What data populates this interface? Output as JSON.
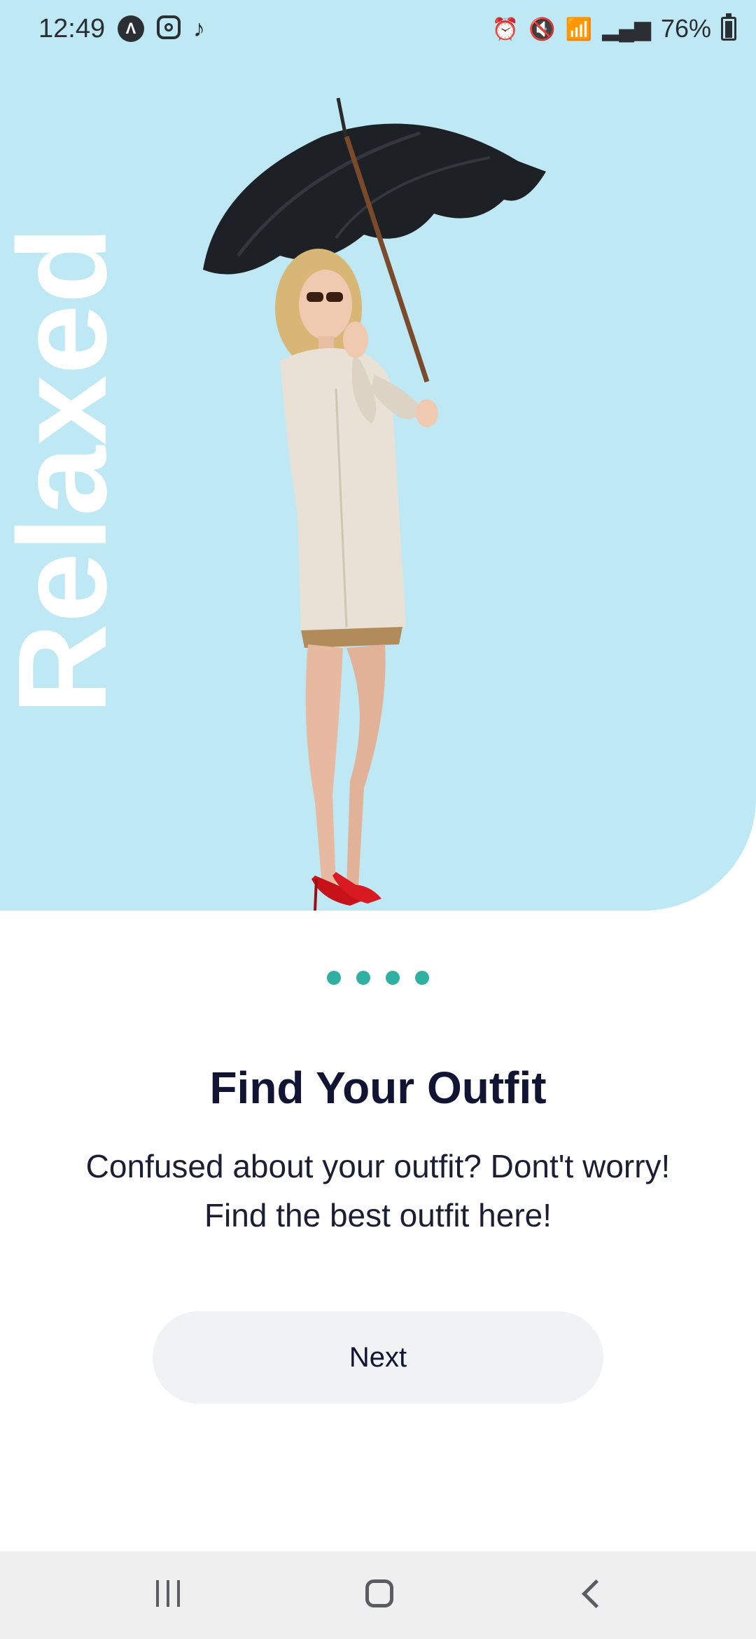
{
  "status_bar": {
    "time": "12:49",
    "battery": "76%",
    "left_icons": [
      "a-letter-icon",
      "instagram-icon",
      "music-note-icon"
    ],
    "right_icons": [
      "alarm-icon",
      "mute-icon",
      "wifi-icon",
      "signal-icon",
      "signal-icon",
      "battery-icon"
    ]
  },
  "hero": {
    "vertical_word": "Relaxed",
    "background_color": "#bfe8f5"
  },
  "pager": {
    "count": 4,
    "color": "#2fb0a2"
  },
  "content": {
    "title": "Find Your Outfit",
    "description": "Confused about your outfit? Dont't worry! Find the best outfit here!"
  },
  "buttons": {
    "next_label": "Next"
  },
  "nav": {
    "items": [
      "recent-apps",
      "home",
      "back"
    ]
  }
}
